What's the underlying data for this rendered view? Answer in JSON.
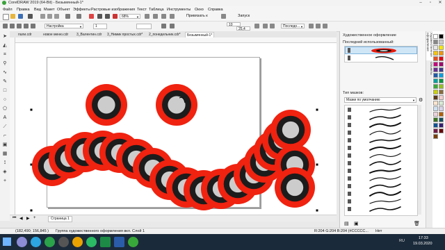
{
  "window": {
    "title": "CorelDRAW 2019 (64-Bit) - Безымянный-1*"
  },
  "menu": [
    "Файл",
    "Правка",
    "Вид",
    "Макет",
    "Объект",
    "Эффекты",
    "Растровые изображения",
    "Текст",
    "Таблица",
    "Инструменты",
    "Окно",
    "Справка"
  ],
  "toolbar1": {
    "zoom": "68%",
    "snap_label": "Привязать к",
    "launch_label": "Запуск"
  },
  "toolbar2": {
    "preset": "Настройка",
    "stroke_width": "1",
    "size_w": "10",
    "size_h": "25,4",
    "order": "Последо..."
  },
  "doc_tabs": [
    "пали.cdr",
    "новое меню.cdr",
    "3_Валентин.cdr",
    "3_Нимик простых.cdr*",
    "2_понедельник.cdr*",
    "Безымянный-1*"
  ],
  "active_tab": "Безымянный-1*",
  "page_tab": "Страница 1",
  "dock": {
    "title": "Художественное оформление",
    "recent_label": "Последний использованный:",
    "brush_type_label": "Тип мазков:",
    "brush_type_value": "Мазки по умолчанию"
  },
  "vtab_label": "Художественное оформление",
  "vtab_label2": "Объекты",
  "status": {
    "coords": "(182,490; 156,845 )",
    "info": "Группа художественного оформления вкл. Слой 1",
    "fill_info": "R:204 G:204 B:204 (#CCCCC...",
    "outline_info": "Нет"
  },
  "taskbar": {
    "lang": "RU",
    "time": "17:33",
    "date": "19.03.2020"
  },
  "colors": {
    "accent": "#f02210",
    "ring": "#1c1c1c",
    "inner": "#cccccc"
  }
}
